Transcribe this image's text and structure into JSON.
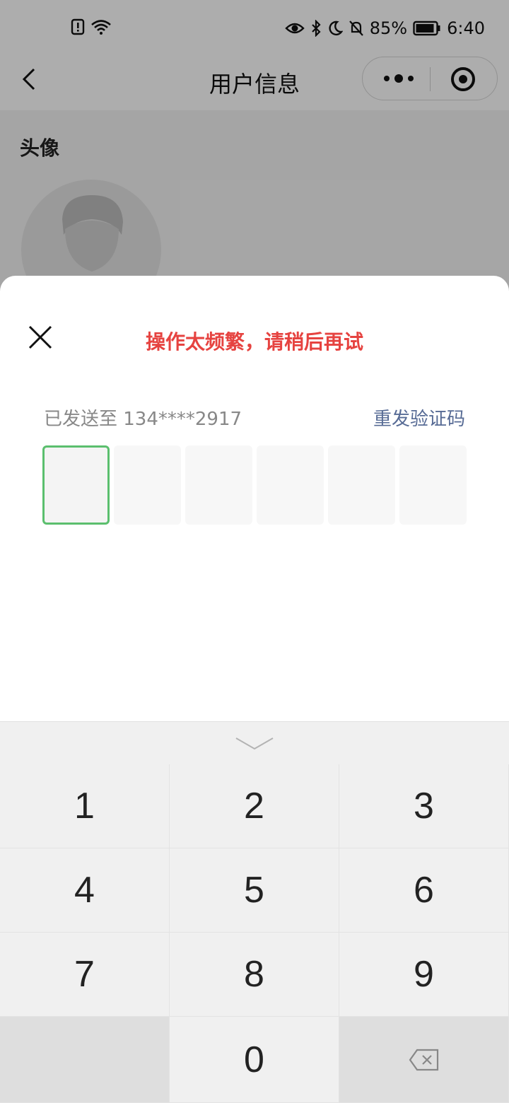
{
  "status_bar": {
    "battery_percent": "85%",
    "time": "6:40",
    "icons_left": [
      "sim-alert-icon",
      "wifi-icon"
    ],
    "icons_right": [
      "eye-icon",
      "bluetooth-icon",
      "moon-icon",
      "bell-off-icon",
      "battery-icon"
    ]
  },
  "nav": {
    "title": "用户信息",
    "back_icon": "chevron-left-icon",
    "menu_icon": "more-dots-icon",
    "close_miniprogram_icon": "target-circle-icon"
  },
  "page": {
    "avatar_label": "头像"
  },
  "sheet": {
    "error_message": "操作太频繁，请稍后再试",
    "sent_to": "已发送至 134****2917",
    "resend_label": "重发验证码",
    "code_length": 6,
    "active_index": 0,
    "accent_color": "#5bbf6e",
    "error_color": "#e64340",
    "link_color": "#576b95"
  },
  "keypad": {
    "keys": [
      "1",
      "2",
      "3",
      "4",
      "5",
      "6",
      "7",
      "8",
      "9",
      "",
      "0",
      "backspace"
    ]
  }
}
